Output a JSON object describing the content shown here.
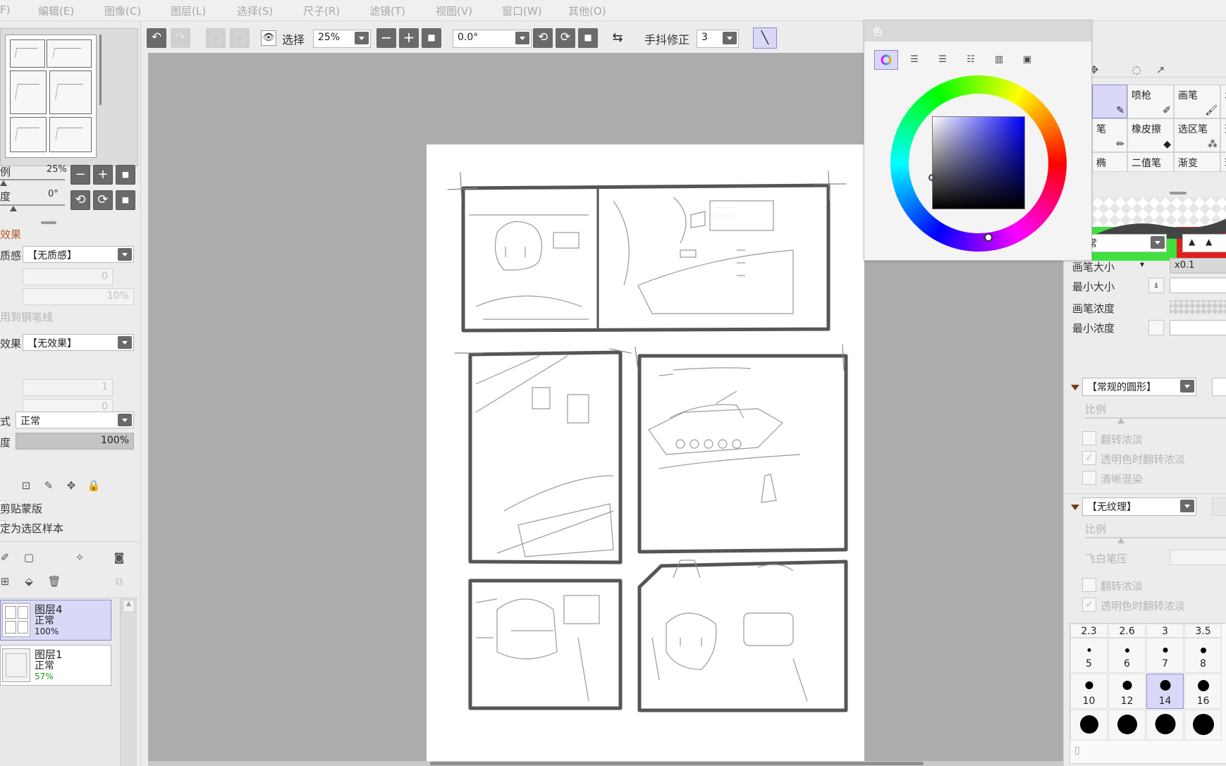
{
  "menubar": {
    "items": [
      {
        "label": "F)"
      },
      {
        "label": "编辑(E)"
      },
      {
        "label": "图像(C)"
      },
      {
        "label": "图层(L)"
      },
      {
        "label": "选择(S)"
      },
      {
        "label": "尺子(R)"
      },
      {
        "label": "滤镜(T)"
      },
      {
        "label": "视图(V)"
      },
      {
        "label": "窗口(W)"
      },
      {
        "label": "其他(O)"
      }
    ]
  },
  "toolbar": {
    "select_label": "选择",
    "zoom_value": "25%",
    "rotation_value": "0.0°",
    "stabilizer_label": "手抖修正",
    "stabilizer_value": "3"
  },
  "left": {
    "scale_label": "例",
    "scale_value": "25%",
    "angle_label": "度",
    "angle_value": "0°",
    "effect_header": "效果",
    "texture_label": "质感",
    "texture_value": "【无质感】",
    "texture_field1": "0",
    "texture_field2": "10%",
    "apply_pen_label": "用到钢笔线",
    "effect_label": "效果",
    "effect_value": "【无效果】",
    "effect_field1": "1",
    "effect_field2": "0",
    "blend_label": "式",
    "blend_value": "正常",
    "opacity_label": "度",
    "opacity_value": "100%",
    "clip_label": "剪贴蒙版",
    "sample_label": "定为选区样本",
    "layers": [
      {
        "name": "图层4",
        "mode": "正常",
        "opacity": "100%",
        "selected": true
      },
      {
        "name": "图层1",
        "mode": "正常",
        "opacity": "57%",
        "selected": false
      }
    ]
  },
  "color_dialog": {
    "title": "色",
    "tabs": [
      "wheel-tab",
      "rgb-slider-tab",
      "hsv-slider-tab",
      "swatch-tab",
      "palette-tab",
      "scratch-tab"
    ],
    "hue": 240,
    "sv_selected": [
      0.0,
      0.35
    ]
  },
  "right": {
    "tools": [
      {
        "label": ""
      },
      {
        "label": "喷枪"
      },
      {
        "label": "画笔"
      },
      {
        "label": "水"
      },
      {
        "label": "笔"
      },
      {
        "label": "橡皮擦"
      },
      {
        "label": "选区笔"
      },
      {
        "label": "选"
      },
      {
        "label": "椭"
      },
      {
        "label": "二值笔"
      },
      {
        "label": "渐变"
      },
      {
        "label": "球"
      }
    ],
    "blend_mode": "正常",
    "brush_size_label": "画笔大小",
    "brush_size_mult": "x0.1",
    "min_size_label": "最小大小",
    "density_label": "画笔浓度",
    "min_density_label": "最小浓度",
    "shape_value": "【常规的圆形】",
    "shape_ratio_label": "比例",
    "invert_label": "翻转浓淡",
    "invert_transparent_label": "透明色时翻转浓淡",
    "clear_blend_label": "清晰混染",
    "texture_value": "【无纹理】",
    "texture_ratio_label": "比例",
    "flying_white_label": "飞白笔压",
    "invert2_label": "翻转浓淡",
    "invert_transparent2_label": "透明色时翻转浓淡",
    "sizes": [
      "2.3",
      "2.6",
      "3",
      "3.5",
      "5",
      "6",
      "7",
      "8",
      "10",
      "12",
      "14",
      "16",
      "",
      "",
      "",
      ""
    ],
    "active_size": "14"
  },
  "colors": {
    "accent_selected": "#d9d9f7",
    "button_dark": "#6a6a6a",
    "canvas_bg": "#acacac",
    "stroke_green": "#3ee13e",
    "stroke_red": "#e01e1e"
  }
}
